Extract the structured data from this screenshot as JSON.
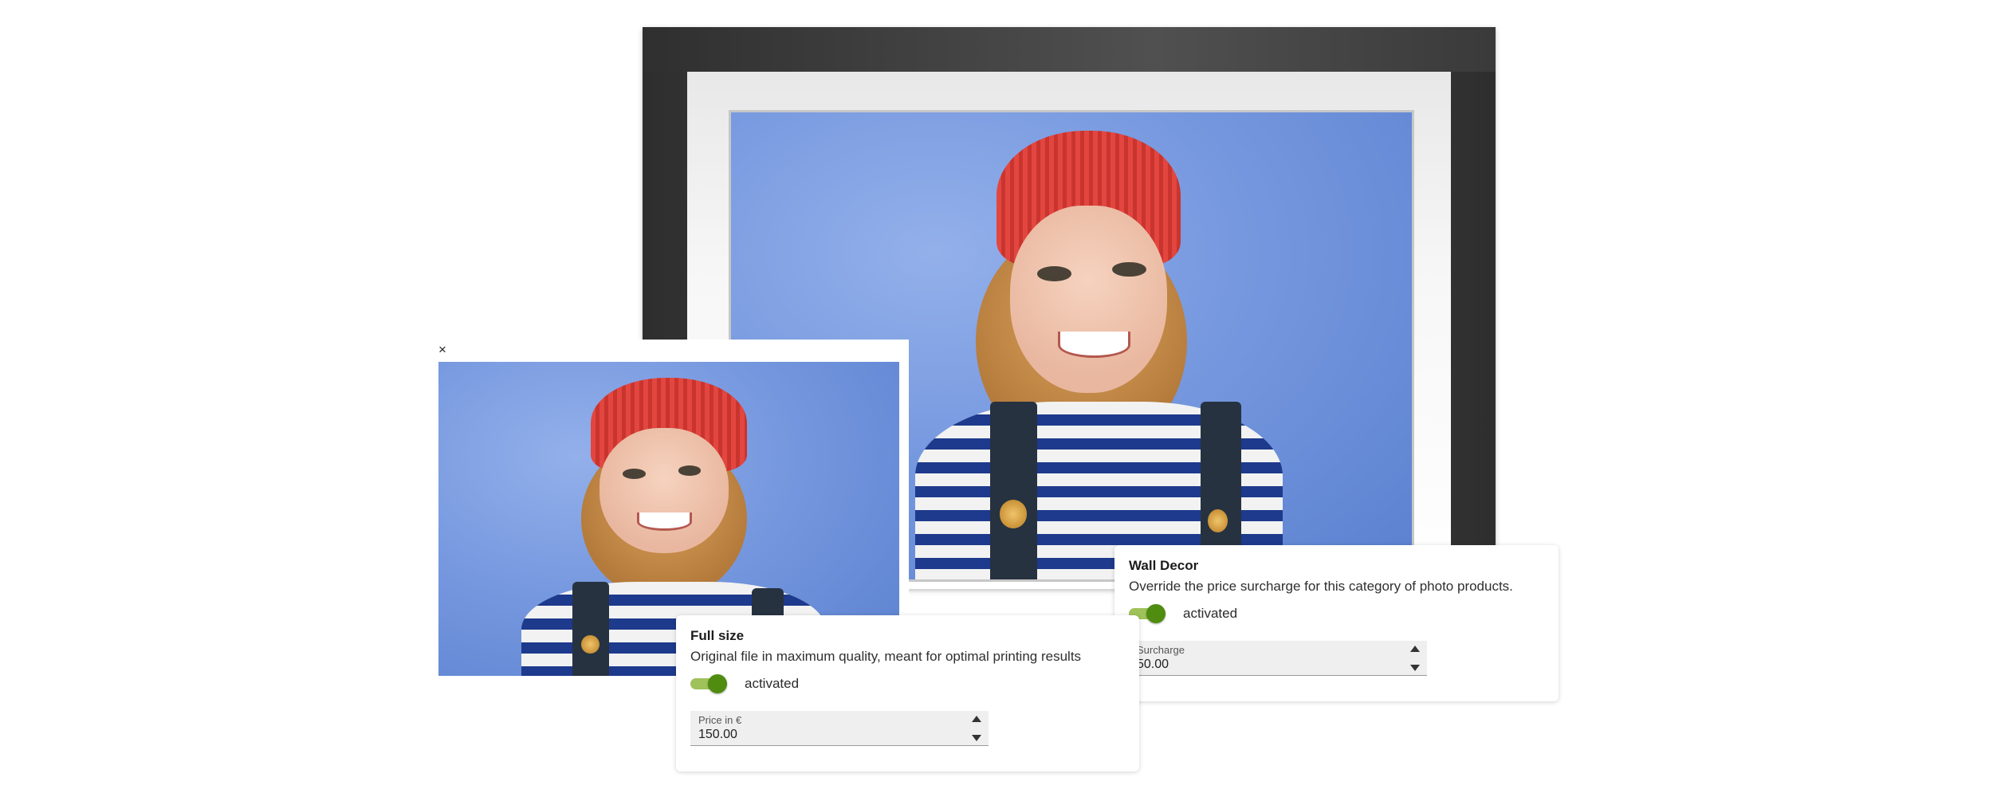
{
  "preview": {
    "close_symbol": "×"
  },
  "full_size": {
    "title": "Full size",
    "description": "Original file in maximum quality, meant for optimal printing results",
    "toggle_state": "activated",
    "toggle_on": true,
    "price_label": "Price in €",
    "price_value": "150.00"
  },
  "wall_decor": {
    "title": "Wall Decor",
    "description": "Override the price surcharge for this category of photo products.",
    "toggle_state": "activated",
    "toggle_on": true,
    "surcharge_label": "Surcharge",
    "surcharge_value": "50.00"
  },
  "colors": {
    "toggle_track": "#9fc25a",
    "toggle_knob": "#4f8c10",
    "photo_background": "#7698df",
    "frame": "#3a3a3a"
  },
  "icons": {
    "close": "close-icon",
    "spin_up": "chevron-up-icon",
    "spin_down": "chevron-down-icon"
  }
}
